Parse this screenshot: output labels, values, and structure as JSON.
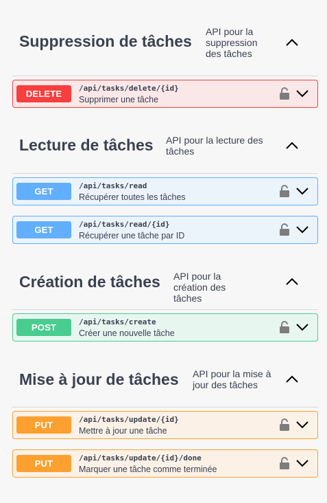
{
  "sections": [
    {
      "title": "Suppression de tâches",
      "description": "API pour la suppression des tâches",
      "operations": [
        {
          "method": "DELETE",
          "path": "/api/tasks/delete/{id}",
          "summary": "Supprimer une tâche"
        }
      ]
    },
    {
      "title": "Lecture de tâches",
      "description": "API pour la lecture des tâches",
      "operations": [
        {
          "method": "GET",
          "path": "/api/tasks/read",
          "summary": "Récupérer toutes les tâches"
        },
        {
          "method": "GET",
          "path": "/api/tasks/read/{id}",
          "summary": "Récupérer une tâche par ID"
        }
      ]
    },
    {
      "title": "Création de tâches",
      "description": "API pour la création des tâches",
      "operations": [
        {
          "method": "POST",
          "path": "/api/tasks/create",
          "summary": "Créer une nouvelle tâche"
        }
      ]
    },
    {
      "title": "Mise à jour de tâches",
      "description": "API pour la mise à jour des tâches",
      "operations": [
        {
          "method": "PUT",
          "path": "/api/tasks/update/{id}",
          "summary": "Mettre à jour une tâche"
        },
        {
          "method": "PUT",
          "path": "/api/tasks/update/{id}/done",
          "summary": "Marquer une tâche comme terminée"
        }
      ]
    }
  ],
  "colors": {
    "DELETE": "#f93e3e",
    "GET": "#61affe",
    "POST": "#49cc90",
    "PUT": "#fca130",
    "text": "#3b4151"
  },
  "icons": {
    "lock": "lock-icon",
    "expand": "chevron-down-icon",
    "collapse": "chevron-up-icon"
  }
}
